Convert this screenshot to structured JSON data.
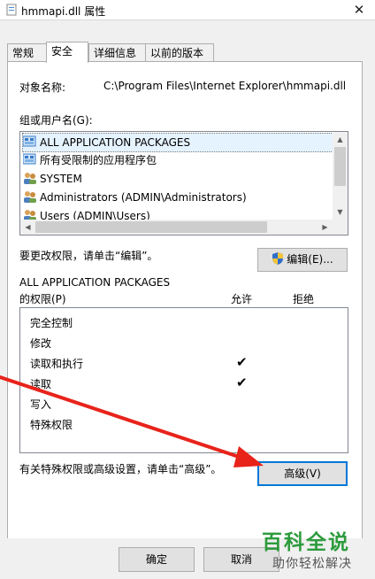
{
  "window": {
    "title": "hmmapi.dll 属性",
    "close_glyph": "✕"
  },
  "tabs": [
    {
      "label": "常规",
      "active": false
    },
    {
      "label": "安全",
      "active": true
    },
    {
      "label": "详细信息",
      "active": false
    },
    {
      "label": "以前的版本",
      "active": false
    }
  ],
  "security": {
    "object_label": "对象名称:",
    "object_path": "C:\\Program Files\\Internet Explorer\\hmmapi.dll",
    "groups_label": "组或用户名(G):",
    "users": [
      {
        "name": "ALL APPLICATION PACKAGES",
        "icon": "packages-icon",
        "selected": true
      },
      {
        "name": "所有受限制的应用程序包",
        "icon": "packages-icon",
        "selected": false
      },
      {
        "name": "SYSTEM",
        "icon": "users-icon",
        "selected": false
      },
      {
        "name": "Administrators (ADMIN\\Administrators)",
        "icon": "users-icon",
        "selected": false
      },
      {
        "name": "Users (ADMIN\\Users)",
        "icon": "users-icon",
        "selected": false
      }
    ],
    "edit_hint": "要更改权限，请单击“编辑”。",
    "edit_button": "编辑(E)...",
    "perm_for": "ALL APPLICATION PACKAGES",
    "perm_label": "的权限(P)",
    "allow_header": "允许",
    "deny_header": "拒绝",
    "permissions": [
      {
        "name": "完全控制",
        "allow": false
      },
      {
        "name": "修改",
        "allow": false
      },
      {
        "name": "读取和执行",
        "allow": true
      },
      {
        "name": "读取",
        "allow": true
      },
      {
        "name": "写入",
        "allow": false
      },
      {
        "name": "特殊权限",
        "allow": false
      }
    ],
    "check_glyph": "✔",
    "advanced_hint": "有关特殊权限或高级设置，请单击“高级”。",
    "advanced_button": "高级(V)"
  },
  "footer": {
    "ok_button": "确定",
    "cancel_button": "取消"
  },
  "watermark": {
    "title": "百科全说",
    "subtitle": "助你轻松解决"
  },
  "colors": {
    "arrow": "#e8231a",
    "selection": "#e5f3ff",
    "focus": "#0078d7",
    "watermark": "#2d9b3c"
  }
}
